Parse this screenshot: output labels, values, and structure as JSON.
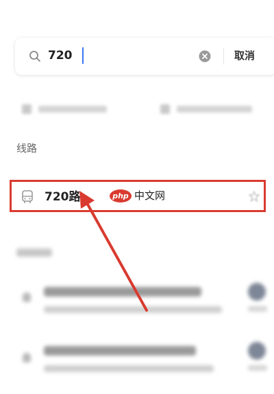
{
  "search": {
    "query": "720",
    "cancel_label": "取消"
  },
  "shortcuts": [
    {
      "icon": "home-icon"
    },
    {
      "icon": "company-icon"
    }
  ],
  "section": {
    "title": "线路"
  },
  "route_result": {
    "icon": "bus-icon",
    "name": "720路"
  },
  "watermark": {
    "logo_text": "php",
    "site_text": "中文网"
  },
  "colors": {
    "highlight": "#d93a2f",
    "caret": "#3a78f2"
  }
}
